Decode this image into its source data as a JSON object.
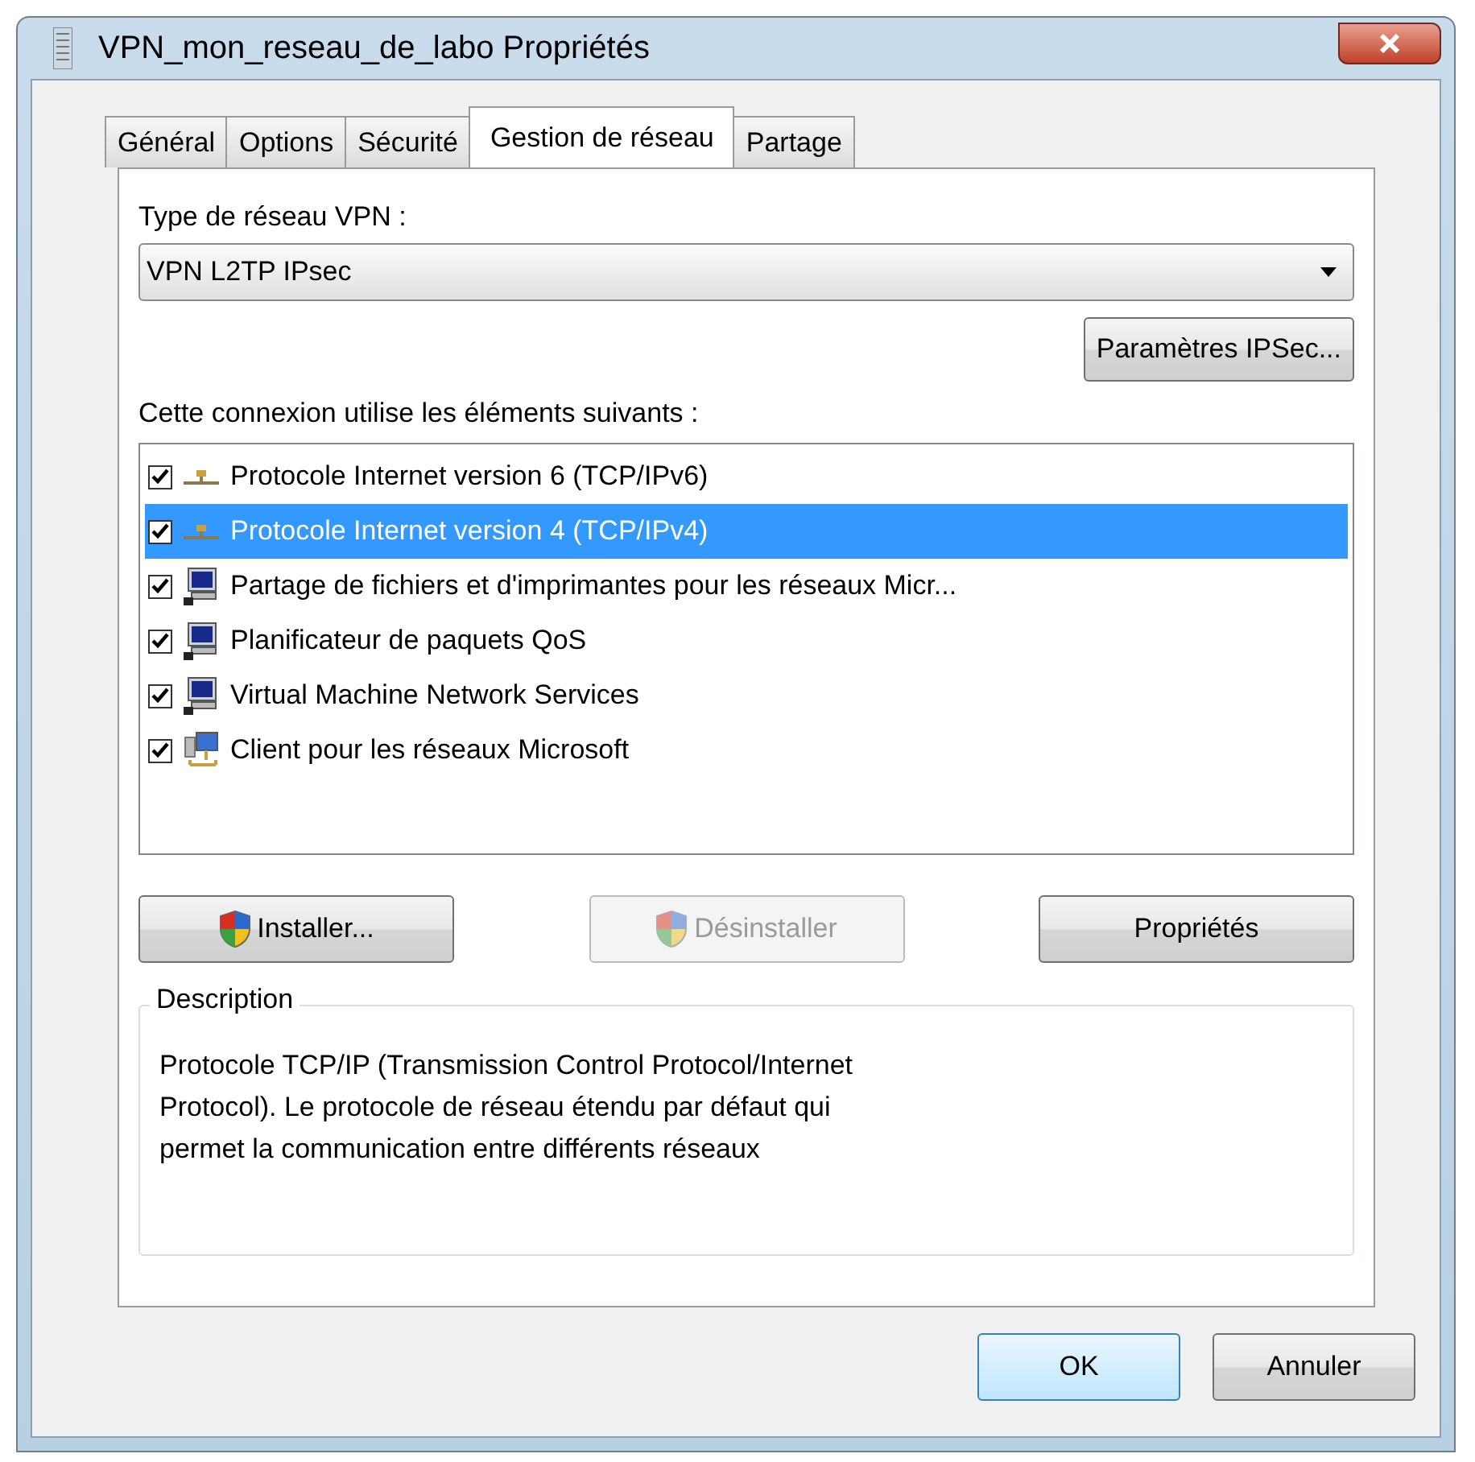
{
  "window": {
    "title": "VPN_mon_reseau_de_labo Propriétés"
  },
  "tabs": [
    {
      "label": "Général",
      "selected": false
    },
    {
      "label": "Options",
      "selected": false
    },
    {
      "label": "Sécurité",
      "selected": false
    },
    {
      "label": "Gestion de réseau",
      "selected": true
    },
    {
      "label": "Partage",
      "selected": false
    }
  ],
  "vpn_type": {
    "label": "Type de réseau VPN :",
    "value": "VPN L2TP IPsec"
  },
  "ipsec_button": "Paramètres IPSec...",
  "components": {
    "label": "Cette connexion utilise les éléments suivants :",
    "items": [
      {
        "kind": "protocol",
        "label": "Protocole Internet version 6 (TCP/IPv6)",
        "checked": true,
        "selected": false
      },
      {
        "kind": "protocol",
        "label": "Protocole Internet version 4 (TCP/IPv4)",
        "checked": true,
        "selected": true
      },
      {
        "kind": "service",
        "label": "Partage de fichiers et d'imprimantes pour les réseaux Micr...",
        "checked": true,
        "selected": false
      },
      {
        "kind": "service",
        "label": "Planificateur de paquets QoS",
        "checked": true,
        "selected": false
      },
      {
        "kind": "service",
        "label": "Virtual Machine Network Services",
        "checked": true,
        "selected": false
      },
      {
        "kind": "client",
        "label": "Client pour les réseaux Microsoft",
        "checked": true,
        "selected": false
      }
    ]
  },
  "actions": [
    {
      "label": "Installer...",
      "shield": true,
      "disabled": false
    },
    {
      "label": "Désinstaller",
      "shield": true,
      "disabled": true
    },
    {
      "label": "Propriétés",
      "shield": false,
      "disabled": false
    }
  ],
  "description": {
    "title": "Description",
    "text": "Protocole TCP/IP (Transmission Control Protocol/Internet Protocol). Le protocole de réseau étendu par défaut qui permet la communication entre différents réseaux"
  },
  "dialog_buttons": [
    {
      "label": "OK",
      "default": true
    },
    {
      "label": "Annuler",
      "default": false
    }
  ]
}
